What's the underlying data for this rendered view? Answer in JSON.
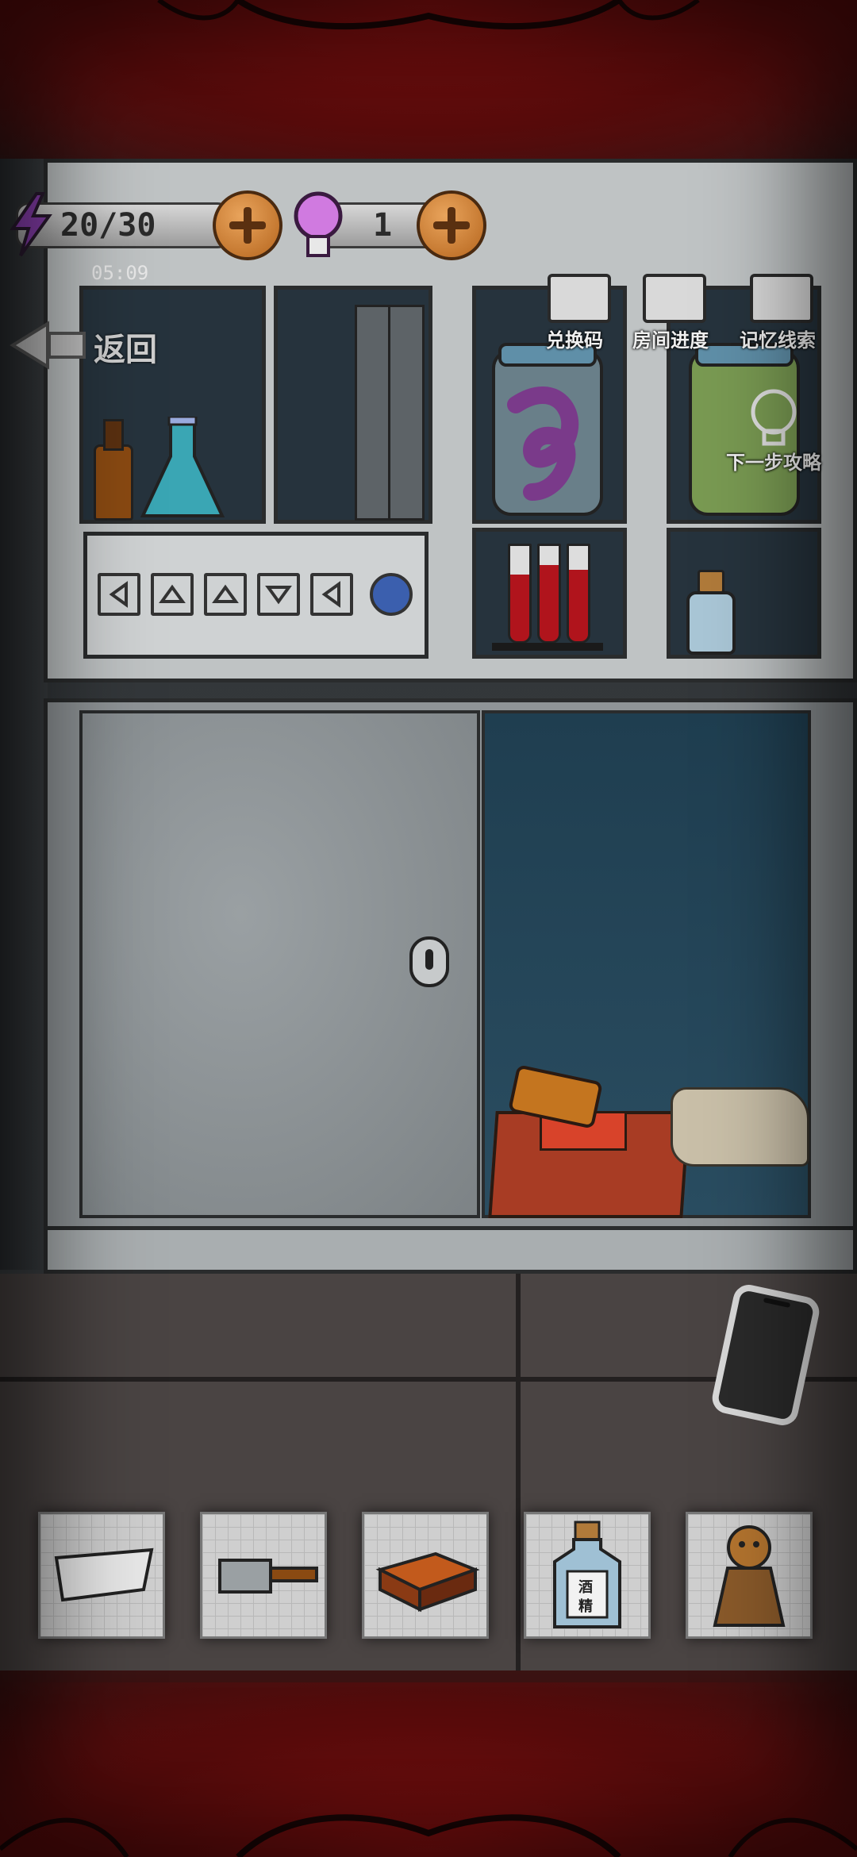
{
  "hud": {
    "energy_icon": "lightning-icon",
    "energy_value": "20/30",
    "hint_icon": "lightbulb-icon",
    "hint_value": "1",
    "timer": "05:09"
  },
  "nav": {
    "back_label": "返回"
  },
  "menu": {
    "redeem_code": "兑换码",
    "room_progress": "房间进度",
    "memory_clues": "记忆线索",
    "next_step_guide": "下一步攻略"
  },
  "puzzle": {
    "arrow_buttons": [
      "left",
      "up",
      "up",
      "down",
      "left"
    ],
    "confirm_color": "#3b5fae"
  },
  "inventory": {
    "items": [
      {
        "name": "paper-scrap"
      },
      {
        "name": "cleaver"
      },
      {
        "name": "matchbox"
      },
      {
        "name": "alcohol-bottle",
        "label_top": "酒",
        "label_bottom": "精"
      },
      {
        "name": "scarecrow-doll"
      }
    ]
  },
  "colors": {
    "frame_red": "#6a0c0c",
    "cabinet_gray": "#cfd2d3",
    "glass_dark": "#26333d",
    "energy_purple": "#8a3fb0"
  }
}
